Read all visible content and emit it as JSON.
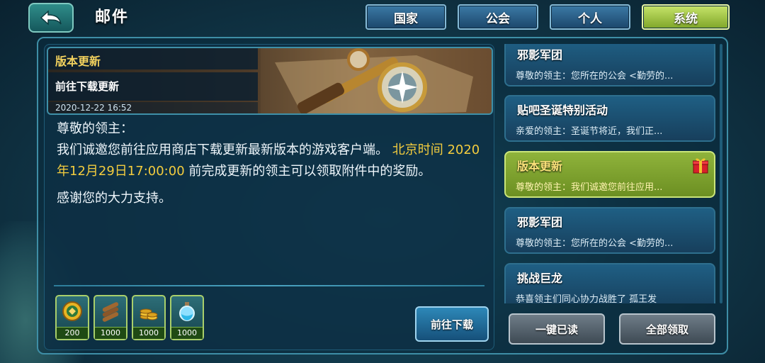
{
  "header": {
    "title": "邮件",
    "tabs": [
      "国家",
      "公会",
      "个人",
      "系统"
    ],
    "active_tab": "系统"
  },
  "detail": {
    "banner_title": "版本更新",
    "banner_subtitle": "前往下载更新",
    "date": "2020-12-22 16:52",
    "greeting": "尊敬的领主：",
    "body_part1": "我们诚邀您前往应用商店下载更新最新版本的游戏客户端。",
    "body_highlight": "北京时间 2020年12月29日17:00:00",
    "body_part2": "前完成更新的领主可以领取附件中的奖励。",
    "thanks": "感谢您的大力支持。",
    "download_label": "前往下载"
  },
  "attachments": [
    {
      "icon": "emblem-coin-icon",
      "qty": "200"
    },
    {
      "icon": "wood-logs-icon",
      "qty": "1000"
    },
    {
      "icon": "gold-coins-icon",
      "qty": "1000"
    },
    {
      "icon": "potion-flask-icon",
      "qty": "1000"
    }
  ],
  "mails": [
    {
      "title": "邪影军团",
      "preview": "尊敬的领主：您所在的公会 <勤劳的...",
      "active": false,
      "gift": false
    },
    {
      "title": "贴吧圣诞特别活动",
      "preview": "亲爱的领主：圣诞节将近，我们正...",
      "active": false,
      "gift": false
    },
    {
      "title": "版本更新",
      "preview": "尊敬的领主：我们诚邀您前往应用...",
      "active": true,
      "gift": true
    },
    {
      "title": "邪影军团",
      "preview": "尊敬的领主：您所在的公会 <勤劳的...",
      "active": false,
      "gift": false
    },
    {
      "title": "挑战巨龙",
      "preview": "恭喜领主们同心协力战胜了 孤王发",
      "active": false,
      "gift": false
    }
  ],
  "buttons": {
    "read_all": "一键已读",
    "claim_all": "全部领取"
  },
  "colors": {
    "highlight": "#f3cc3e",
    "active_tab": "#a8c84a",
    "active_mail": "#8fb33b"
  }
}
